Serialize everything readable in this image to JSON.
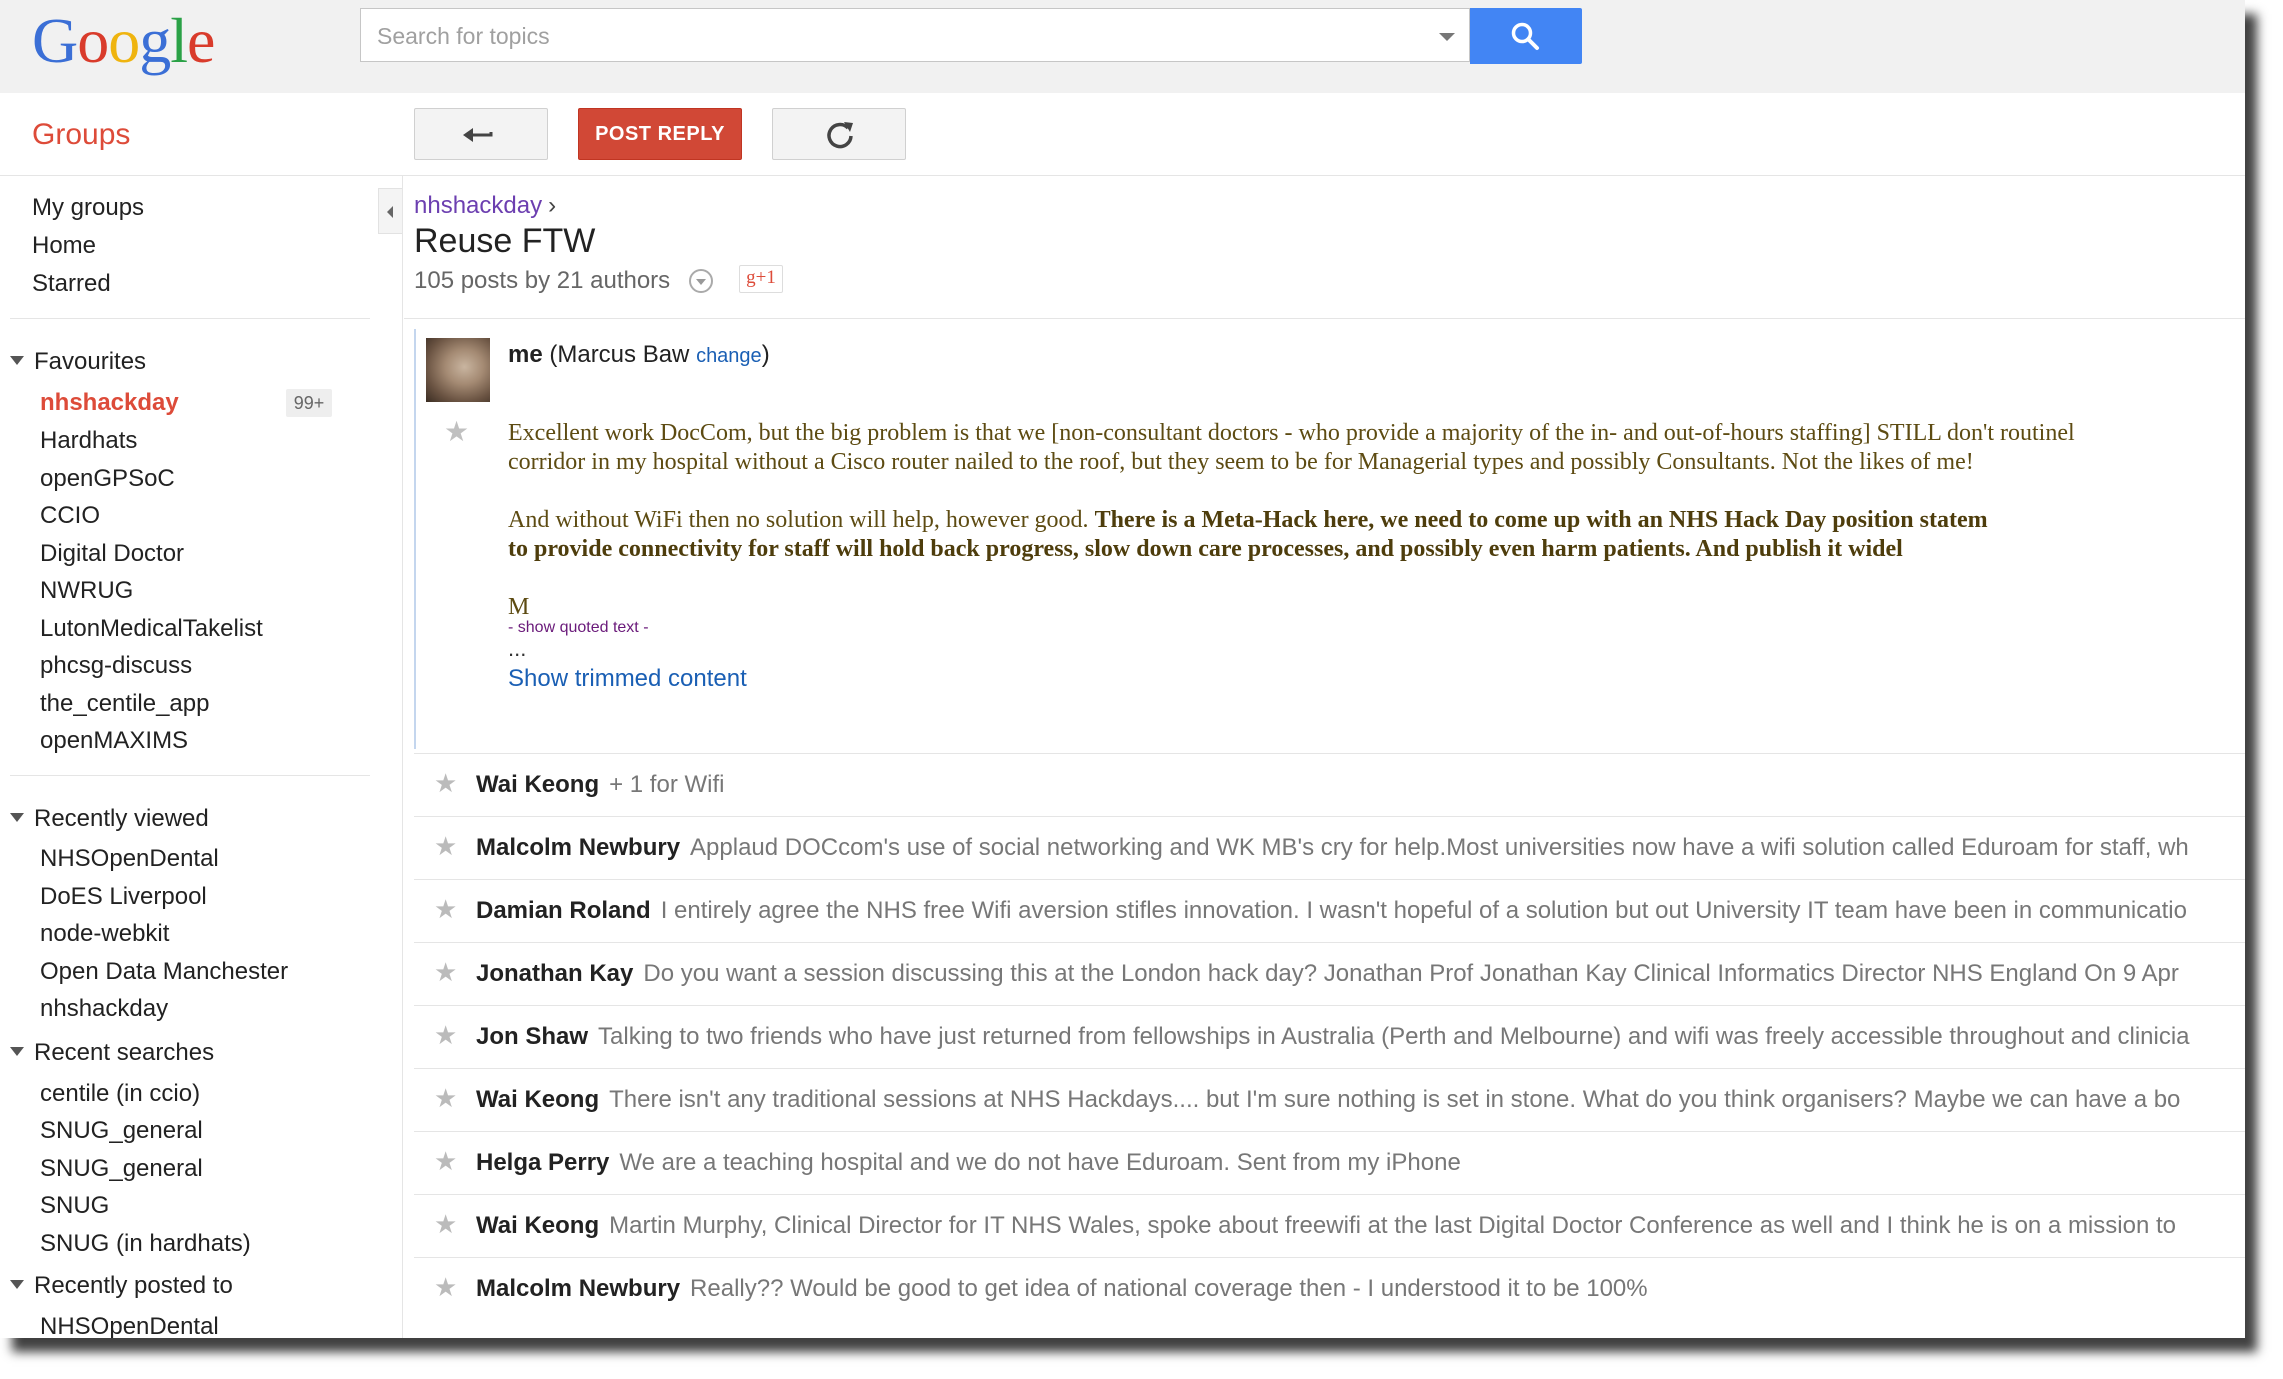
{
  "header": {
    "logo": [
      "G",
      "o",
      "o",
      "g",
      "l",
      "e"
    ],
    "search_placeholder": "Search for topics"
  },
  "toolbar": {
    "app_title": "Groups",
    "post_reply_label": "POST REPLY"
  },
  "sidebar": {
    "nav": [
      "My groups",
      "Home",
      "Starred"
    ],
    "favourites_heading": "Favourites",
    "favourites": [
      "nhshackday",
      "Hardhats",
      "openGPSoC",
      "CCIO",
      "Digital Doctor",
      "NWRUG",
      "LutonMedicalTakelist",
      "phcsg-discuss",
      "the_centile_app",
      "openMAXIMS"
    ],
    "unread_badge": "99+",
    "recently_viewed_heading": "Recently viewed",
    "recently_viewed": [
      "NHSOpenDental",
      "DoES Liverpool",
      "node-webkit",
      "Open Data Manchester",
      "nhshackday"
    ],
    "recent_searches_heading": "Recent searches",
    "recent_searches": [
      "centile (in ccio)",
      "SNUG_general",
      "SNUG_general",
      "SNUG",
      "SNUG (in hardhats)"
    ],
    "recently_posted_heading": "Recently posted to",
    "recently_posted": [
      "NHSOpenDental"
    ]
  },
  "thread": {
    "breadcrumb_group": "nhshackday",
    "breadcrumb_sep": "›",
    "title": "Reuse FTW",
    "stats": "105 posts by 21 authors",
    "plusone": "g+1"
  },
  "post": {
    "author": "me",
    "author_name": "(Marcus Baw",
    "change_label": "change",
    "author_close": ")",
    "para1_line1": "Excellent work DocCom, but the big problem is that we [non-consultant doctors - who provide a majority of the in- and out-of-hours staffing] STILL don't routinel",
    "para1_line2": "corridor in my hospital without a Cisco router nailed to the roof, but they seem to be for Managerial types and possibly Consultants. Not the likes of me!",
    "para2_line1_plain": "And without WiFi then no solution will help, however good. ",
    "para2_line1_bold": "There is a Meta-Hack here, we need to come up with an NHS Hack Day position statem",
    "para2_line2_bold": "to provide connectivity for staff will hold back progress, slow down care processes, and possibly even harm patients. And publish it widel",
    "signoff": "M",
    "show_quoted": "- show quoted text -",
    "ellipsis": "...",
    "show_trimmed": "Show trimmed content"
  },
  "replies": [
    {
      "author": "Wai Keong",
      "snippet": "+ 1 for Wifi"
    },
    {
      "author": "Malcolm Newbury",
      "snippet": "Applaud DOCcom's use of social networking and WK MB's cry for help.Most universities now have a wifi solution called Eduroam for staff, wh"
    },
    {
      "author": "Damian Roland",
      "snippet": "I entirely agree the NHS free Wifi aversion stifles innovation. I wasn't hopeful of a solution but out University IT team have been in communicatio"
    },
    {
      "author": "Jonathan Kay",
      "snippet": "Do you want a session discussing this at the London hack day? Jonathan Prof Jonathan Kay Clinical Informatics Director NHS England On 9 Apr"
    },
    {
      "author": "Jon Shaw",
      "snippet": "Talking to two friends who have just returned from fellowships in Australia (Perth and Melbourne) and wifi was freely accessible throughout and clinicia"
    },
    {
      "author": "Wai Keong",
      "snippet": "There isn't any traditional sessions at NHS Hackdays.... but I'm sure nothing is set in stone. What do you think organisers? Maybe we can have a bo"
    },
    {
      "author": "Helga Perry",
      "snippet": "We are a teaching hospital and we do not have Eduroam. Sent from my iPhone"
    },
    {
      "author": "Wai Keong",
      "snippet": "Martin Murphy, Clinical Director for IT NHS Wales, spoke about freewifi at the last Digital Doctor Conference as well and I think he is on a mission to"
    },
    {
      "author": "Malcolm Newbury",
      "snippet": "Really?? Would be good to get idea of national coverage then - I understood it to be 100%"
    }
  ],
  "colors": {
    "accent_red": "#dd4b39",
    "search_blue": "#4285f4",
    "link_blue": "#1a5fb4",
    "topbar_gray": "#f1f1f1"
  }
}
